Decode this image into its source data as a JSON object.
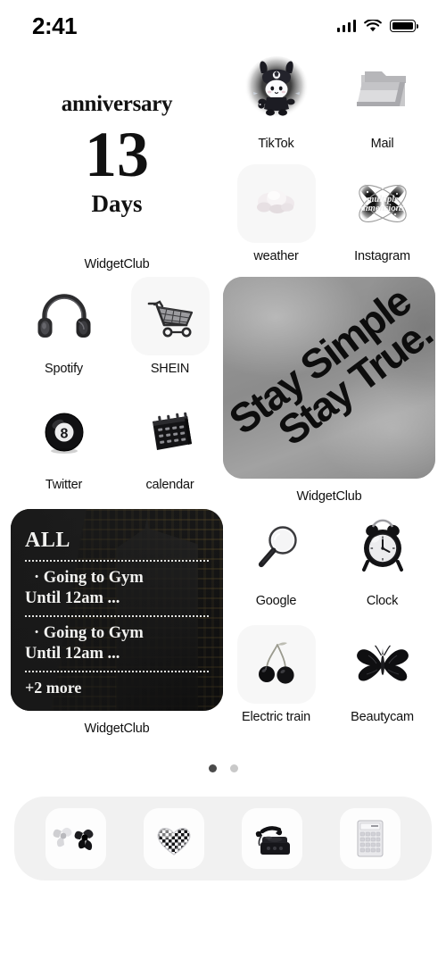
{
  "status_bar": {
    "time": "2:41",
    "cellular_icon": "cellular-signal-icon",
    "wifi_icon": "wifi-icon",
    "battery_icon": "battery-full-icon"
  },
  "home_screen": {
    "widgets": {
      "anniversary": {
        "title": "anniversary",
        "count": "13",
        "unit": "Days",
        "label": "WidgetClub"
      },
      "quote_photo": {
        "line1": "Stay Simple",
        "line2": "Stay True.",
        "label": "WidgetClub"
      },
      "reminders": {
        "header": "ALL",
        "items": [
          {
            "title": "· Going to Gym",
            "detail": "Until 12am ..."
          },
          {
            "title": "· Going to Gym",
            "detail": "Until 12am ..."
          }
        ],
        "more": "+2 more",
        "label": "WidgetClub"
      }
    },
    "apps": [
      {
        "label": "TikTok",
        "icon": "kuromi-character-icon"
      },
      {
        "label": "Mail",
        "icon": "folder-icon"
      },
      {
        "label": "weather",
        "icon": "cloud-icon"
      },
      {
        "label": "Instagram",
        "icon": "butterfly-star-multiple-dimensions-icon"
      },
      {
        "label": "Spotify",
        "icon": "headphones-icon"
      },
      {
        "label": "SHEIN",
        "icon": "shopping-cart-icon"
      },
      {
        "label": "Twitter",
        "icon": "magic-8-ball-icon"
      },
      {
        "label": "calendar",
        "icon": "black-calendar-icon"
      },
      {
        "label": "Google",
        "icon": "magnifying-glass-icon"
      },
      {
        "label": "Clock",
        "icon": "alarm-clock-icon"
      },
      {
        "label": "Electric train",
        "icon": "cherries-icon"
      },
      {
        "label": "Beautycam",
        "icon": "butterfly-icon"
      }
    ],
    "page_indicator": {
      "total": 2,
      "active": 1
    },
    "dock": [
      {
        "icon": "ribbon-bows-icon"
      },
      {
        "icon": "checkered-heart-icon"
      },
      {
        "icon": "rotary-telephone-icon"
      },
      {
        "icon": "calculator-icon"
      }
    ]
  },
  "colors": {
    "background": "#ffffff",
    "label_text": "#101010",
    "dock_bg": "#f1f1f1",
    "dot_active": "#4a4a4a",
    "dot_inactive": "#c9c9c9"
  }
}
